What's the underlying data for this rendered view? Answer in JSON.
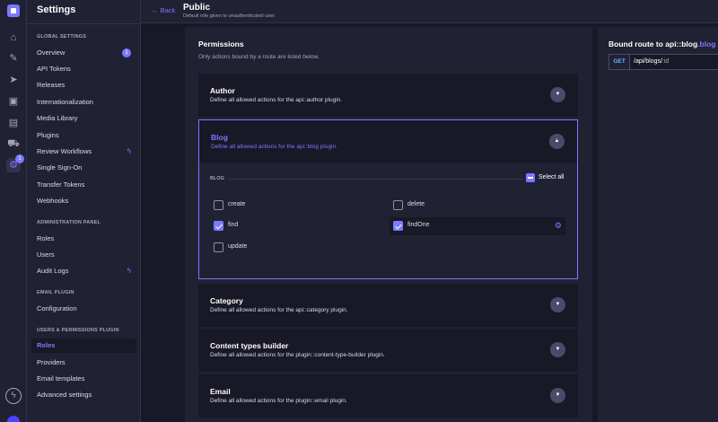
{
  "rail": {
    "icons": [
      "logo-icon",
      "home-icon",
      "feather-icon",
      "send-icon",
      "image-icon",
      "layout-icon",
      "cart-icon",
      "gear-icon"
    ],
    "settings_badge": "1"
  },
  "settings_nav": {
    "title": "Settings",
    "sections": [
      {
        "label": "GLOBAL SETTINGS",
        "items": [
          {
            "label": "Overview",
            "badge": "1"
          },
          {
            "label": "API Tokens"
          },
          {
            "label": "Releases"
          },
          {
            "label": "Internationalization"
          },
          {
            "label": "Media Library"
          },
          {
            "label": "Plugins"
          },
          {
            "label": "Review Workflows",
            "bolt": true
          },
          {
            "label": "Single Sign-On"
          },
          {
            "label": "Transfer Tokens"
          },
          {
            "label": "Webhooks"
          }
        ]
      },
      {
        "label": "ADMINISTRATION PANEL",
        "items": [
          {
            "label": "Roles"
          },
          {
            "label": "Users"
          },
          {
            "label": "Audit Logs",
            "bolt": true
          }
        ]
      },
      {
        "label": "EMAIL PLUGIN",
        "items": [
          {
            "label": "Configuration"
          }
        ]
      },
      {
        "label": "USERS & PERMISSIONS PLUGIN",
        "items": [
          {
            "label": "Roles",
            "active": true
          },
          {
            "label": "Providers"
          },
          {
            "label": "Email templates"
          },
          {
            "label": "Advanced settings"
          }
        ]
      }
    ]
  },
  "header": {
    "back_label": "Back",
    "title": "Public",
    "subtitle": "Default role given to unauthenticated user."
  },
  "permissions": {
    "title": "Permissions",
    "subtitle": "Only actions bound by a route are listed below.",
    "plugins": [
      {
        "name": "Author",
        "desc": "Define all allowed actions for the api::author plugin."
      },
      {
        "name": "Blog",
        "desc": "Define all allowed actions for the api::blog plugin.",
        "expanded": true
      },
      {
        "name": "Category",
        "desc": "Define all allowed actions for the api::category plugin."
      },
      {
        "name": "Content types builder",
        "desc": "Define all allowed actions for the plugin::content-type-builder plugin."
      },
      {
        "name": "Email",
        "desc": "Define all allowed actions for the plugin::email plugin."
      }
    ],
    "blog": {
      "group_label": "BLOG",
      "select_all_label": "Select all",
      "actions": [
        {
          "label": "create",
          "checked": false
        },
        {
          "label": "delete",
          "checked": false
        },
        {
          "label": "find",
          "checked": true
        },
        {
          "label": "findOne",
          "checked": true
        },
        {
          "label": "update",
          "checked": false
        }
      ]
    }
  },
  "bound_route": {
    "title_prefix": "Bound route to",
    "title_api": "api::blog",
    "title_dot": ".",
    "title_action": "blog",
    "method": "GET",
    "path_prefix": "/api/blogs/",
    "path_param": ":id"
  },
  "colors": {
    "accent": "#7b79ff",
    "background": "#181826",
    "panel": "#212134",
    "get_method": "#66b7f1"
  }
}
